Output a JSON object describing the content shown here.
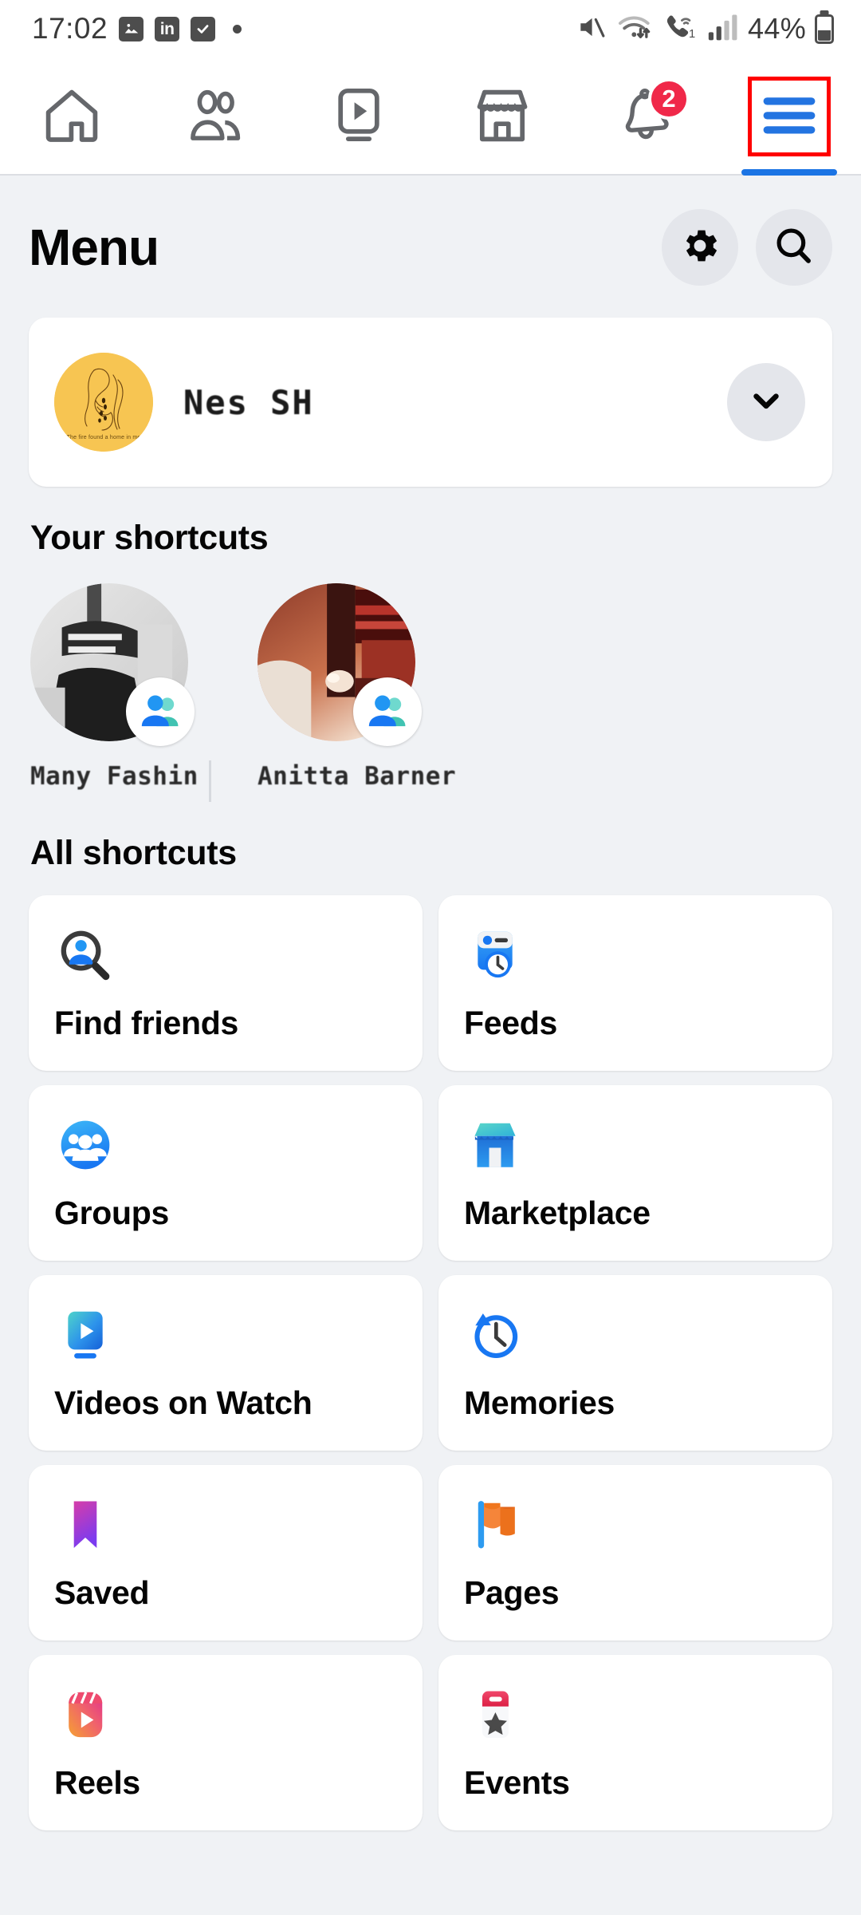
{
  "status_bar": {
    "time": "17:02",
    "left_icons": [
      "photos-icon",
      "linkedin-icon",
      "tasks-checkbox-icon",
      "dot-indicator"
    ],
    "linkedin_label": "in",
    "right_icons": [
      "mute-icon",
      "wifi-icon",
      "wifi-calling-icon",
      "signal-bars-icon"
    ],
    "wifi_calling_label": "1",
    "battery_text": "44%"
  },
  "top_nav": {
    "tabs": [
      {
        "name": "home",
        "icon": "home-icon",
        "badge": null,
        "active": false
      },
      {
        "name": "friends",
        "icon": "friends-icon",
        "badge": null,
        "active": false
      },
      {
        "name": "video",
        "icon": "video-icon",
        "badge": null,
        "active": false
      },
      {
        "name": "marketplace",
        "icon": "marketplace-icon",
        "badge": null,
        "active": false
      },
      {
        "name": "notifications",
        "icon": "bell-icon",
        "badge": "2",
        "active": false
      },
      {
        "name": "menu",
        "icon": "hamburger-menu-icon",
        "badge": null,
        "active": true
      }
    ]
  },
  "header": {
    "title": "Menu",
    "settings_icon": "gear-icon",
    "search_icon": "search-icon"
  },
  "profile": {
    "name": "Nes SH",
    "avatar_caption": "The fire found a home in me",
    "expand_icon": "chevron-down-icon"
  },
  "your_shortcuts": {
    "title": "Your shortcuts",
    "items": [
      {
        "name": "Many Fashin",
        "badge_icon": "group-people-icon"
      },
      {
        "name": "Anitta Barner",
        "badge_icon": "group-people-icon"
      }
    ]
  },
  "all_shortcuts": {
    "title": "All shortcuts",
    "items": [
      {
        "label": "Find friends",
        "icon": "find-friends-icon"
      },
      {
        "label": "Feeds",
        "icon": "feeds-icon"
      },
      {
        "label": "Groups",
        "icon": "groups-icon"
      },
      {
        "label": "Marketplace",
        "icon": "marketplace-store-icon"
      },
      {
        "label": "Videos on Watch",
        "icon": "videos-watch-icon"
      },
      {
        "label": "Memories",
        "icon": "memories-clock-icon"
      },
      {
        "label": "Saved",
        "icon": "saved-bookmark-icon"
      },
      {
        "label": "Pages",
        "icon": "pages-flag-icon"
      },
      {
        "label": "Reels",
        "icon": "reels-icon"
      },
      {
        "label": "Events",
        "icon": "events-calendar-icon"
      }
    ]
  },
  "colors": {
    "brand_blue": "#1877F2",
    "active_blue": "#1B74E4",
    "badge_red": "#F02849",
    "annotation_red": "#FF0000",
    "page_bg": "#F0F2F5",
    "card_bg": "#FFFFFF",
    "avatar_gold": "#F7C552"
  }
}
